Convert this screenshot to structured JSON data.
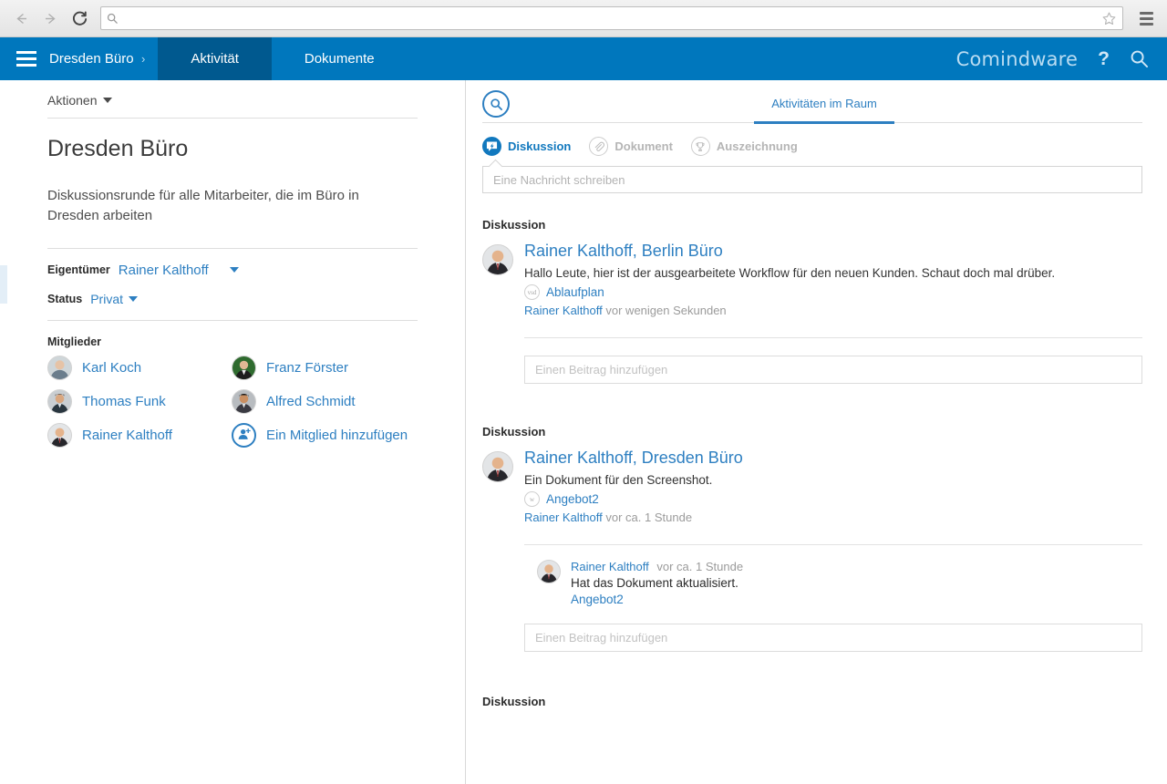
{
  "browser": {
    "back_icon": "back-arrow-icon",
    "forward_icon": "forward-arrow-icon",
    "reload_icon": "reload-icon",
    "url_value": "",
    "url_placeholder": "",
    "bookmark_icon": "star-icon",
    "menu_icon": "hamburger-menu-icon"
  },
  "appbar": {
    "breadcrumb": "Dresden Büro",
    "breadcrumb_chevron": "›",
    "tabs": [
      {
        "label": "Aktivität",
        "active": true
      },
      {
        "label": "Dokumente",
        "active": false
      }
    ],
    "brand": "Comindware",
    "help_label": "?",
    "search_icon": "search-icon"
  },
  "left_panel": {
    "actions_label": "Aktionen",
    "room_title": "Dresden Büro",
    "room_description": "Diskussionsrunde für alle Mitarbeiter, die im Büro in Dresden arbeiten",
    "owner_label": "Eigentümer",
    "owner_value": "Rainer Kalthoff",
    "status_label": "Status",
    "status_value": "Privat",
    "members_label": "Mitglieder",
    "members": [
      {
        "name": "Karl Koch"
      },
      {
        "name": "Franz Förster"
      },
      {
        "name": "Thomas Funk"
      },
      {
        "name": "Alfred Schmidt"
      },
      {
        "name": "Rainer Kalthoff"
      }
    ],
    "add_member_label": "Ein Mitglied hinzufügen"
  },
  "right_panel": {
    "search_icon": "search-icon",
    "room_tab": "Aktivitäten im Raum",
    "filters": [
      {
        "label": "Diskussion",
        "icon": "discussion-icon",
        "active": true
      },
      {
        "label": "Dokument",
        "icon": "paperclip-icon",
        "active": false
      },
      {
        "label": "Auszeichnung",
        "icon": "trophy-icon",
        "active": false
      }
    ],
    "composer_placeholder": "Eine Nachricht schreiben",
    "reply_placeholder": "Einen Beitrag hinzufügen",
    "feed": [
      {
        "section_title": "Diskussion",
        "author": "Rainer Kalthoff, Berlin Büro",
        "text": "Hallo Leute, hier ist der ausgearbeitete Workflow für den neuen Kunden. Schaut doch mal drüber.",
        "attachment": {
          "name": "Ablaufplan",
          "type": "vsd"
        },
        "meta_author": "Rainer Kalthoff",
        "meta_time": "vor wenigen Sekunden",
        "replies": []
      },
      {
        "section_title": "Diskussion",
        "author": "Rainer Kalthoff, Dresden Büro",
        "text": "Ein Dokument für den Screenshot.",
        "attachment": {
          "name": "Angebot2",
          "type": "w"
        },
        "meta_author": "Rainer Kalthoff",
        "meta_time": "vor ca. 1 Stunde",
        "replies": [
          {
            "author": "Rainer Kalthoff",
            "time": "vor ca. 1 Stunde",
            "text": "Hat das Dokument aktualisiert.",
            "link": "Angebot2"
          }
        ]
      },
      {
        "section_title": "Diskussion"
      }
    ]
  },
  "colors": {
    "brand_blue": "#0077bd",
    "active_tab_blue": "#00598f",
    "link_blue": "#2d7fc1",
    "accent_blue": "#1178be"
  }
}
